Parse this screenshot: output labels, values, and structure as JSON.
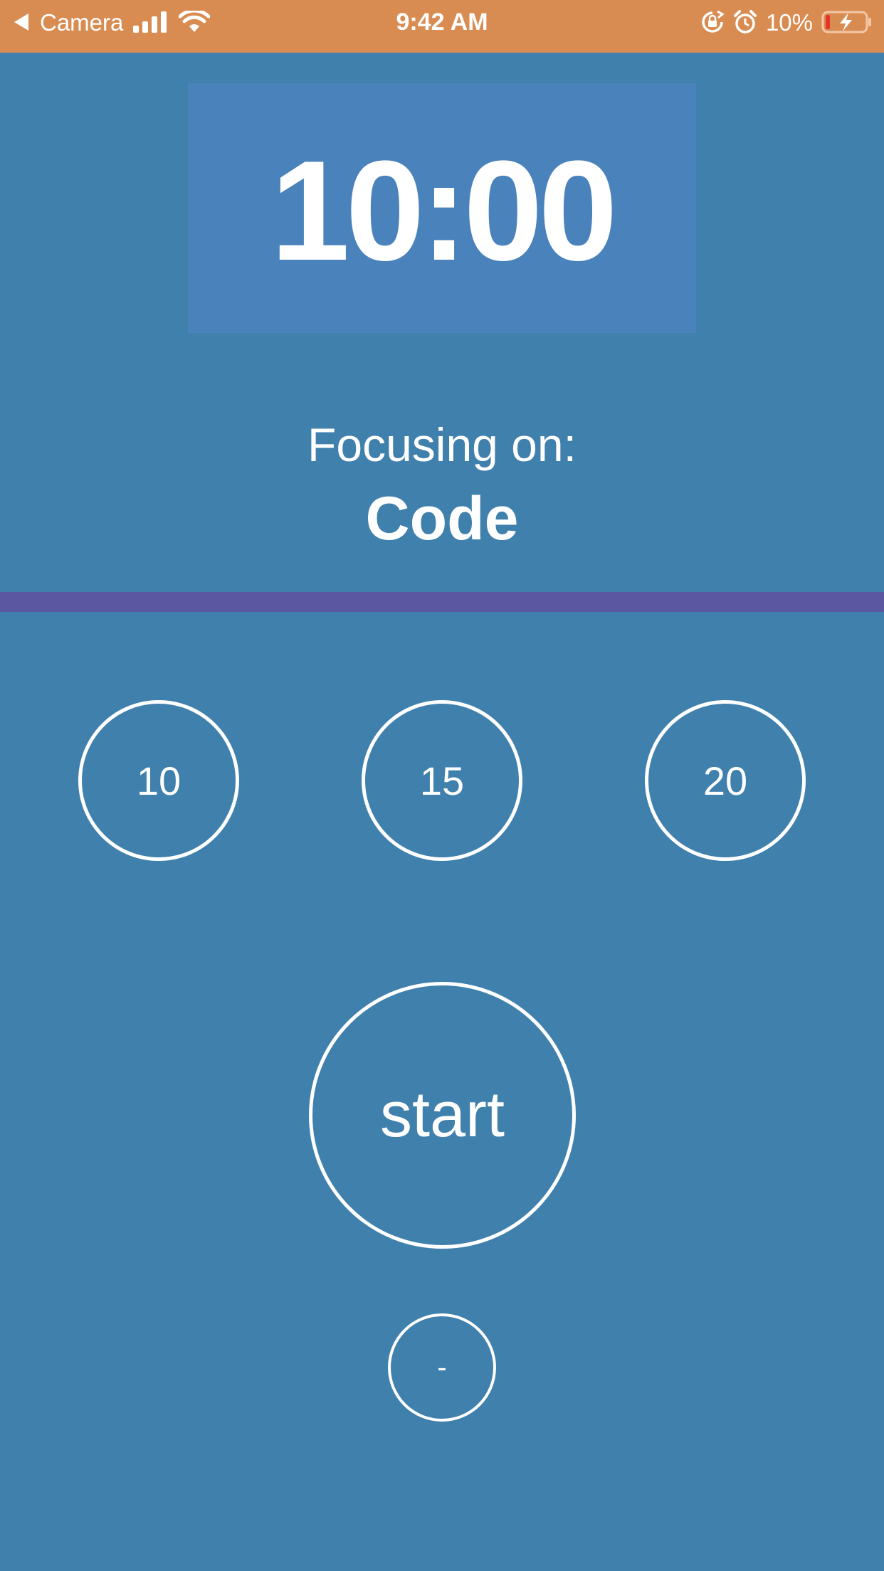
{
  "status_bar": {
    "back_label": "Camera",
    "time": "9:42 AM",
    "battery_percent": "10%",
    "icons": [
      "back-arrow-icon",
      "cellular-signal-icon",
      "wifi-icon",
      "rotation-lock-icon",
      "alarm-icon",
      "battery-charging-icon"
    ],
    "background_color": "#d98c51"
  },
  "timer": {
    "display": "10:00",
    "box_color": "#4a82bb"
  },
  "focus": {
    "label": "Focusing on:",
    "task": "Code"
  },
  "presets": [
    {
      "label": "10"
    },
    {
      "label": "15"
    },
    {
      "label": "20"
    }
  ],
  "controls": {
    "start_label": "start",
    "minus_label": "-"
  },
  "colors": {
    "background": "#4080ac",
    "divider": "#5b58a1",
    "text": "#ffffff"
  }
}
